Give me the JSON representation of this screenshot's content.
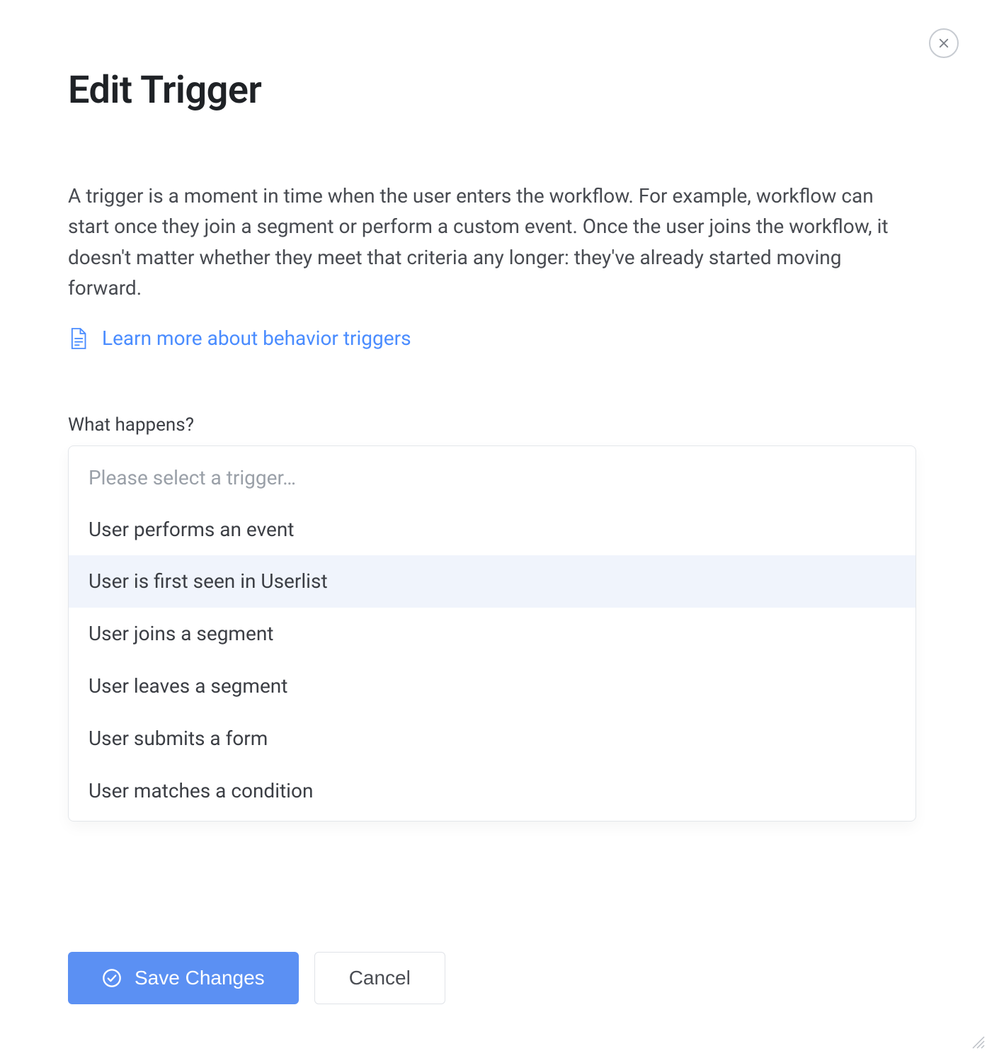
{
  "header": {
    "title": "Edit Trigger"
  },
  "body": {
    "description": "A trigger is a moment in time when the user enters the workflow. For example, workflow can start once they join a segment or perform a custom event. Once the user joins the workflow, it doesn't matter whether they meet that criteria any longer: they've already started moving forward.",
    "learn_more": "Learn more about behavior triggers"
  },
  "form": {
    "what_happens_label": "What happens?",
    "trigger_select": {
      "placeholder": "Please select a trigger…",
      "selected": null,
      "highlighted_index": 1,
      "options": [
        "User performs an event",
        "User is first seen in Userlist",
        "User joins a segment",
        "User leaves a segment",
        "User submits a form",
        "User matches a condition"
      ]
    }
  },
  "footer": {
    "save_label": "Save Changes",
    "cancel_label": "Cancel"
  }
}
